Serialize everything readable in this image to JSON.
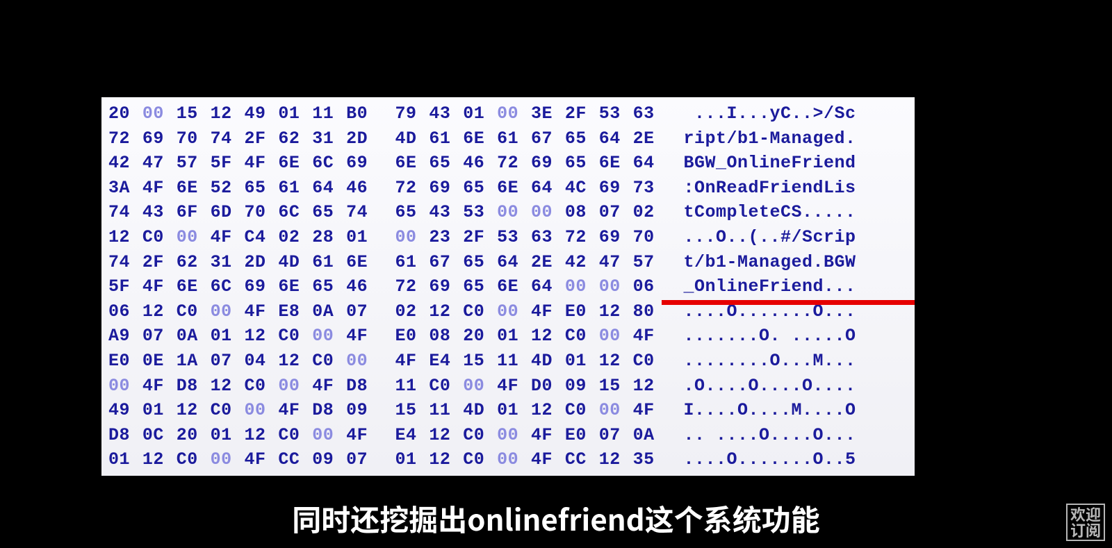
{
  "caption": "同时还挖掘出onlinefriend这个系统功能",
  "stamp": {
    "line1": "欢迎",
    "line2": "订阅"
  },
  "rows": [
    {
      "bytes": [
        "20",
        "00",
        "15",
        "12",
        "49",
        "01",
        "11",
        "B0",
        "79",
        "43",
        "01",
        "00",
        "3E",
        "2F",
        "53",
        "63"
      ],
      "ascii": " ...I...yC..>/Sc"
    },
    {
      "bytes": [
        "72",
        "69",
        "70",
        "74",
        "2F",
        "62",
        "31",
        "2D",
        "4D",
        "61",
        "6E",
        "61",
        "67",
        "65",
        "64",
        "2E"
      ],
      "ascii": "ript/b1-Managed."
    },
    {
      "bytes": [
        "42",
        "47",
        "57",
        "5F",
        "4F",
        "6E",
        "6C",
        "69",
        "6E",
        "65",
        "46",
        "72",
        "69",
        "65",
        "6E",
        "64"
      ],
      "ascii": "BGW_OnlineFriend"
    },
    {
      "bytes": [
        "3A",
        "4F",
        "6E",
        "52",
        "65",
        "61",
        "64",
        "46",
        "72",
        "69",
        "65",
        "6E",
        "64",
        "4C",
        "69",
        "73"
      ],
      "ascii": ":OnReadFriendLis"
    },
    {
      "bytes": [
        "74",
        "43",
        "6F",
        "6D",
        "70",
        "6C",
        "65",
        "74",
        "65",
        "43",
        "53",
        "00",
        "00",
        "08",
        "07",
        "02"
      ],
      "ascii": "tCompleteCS....."
    },
    {
      "bytes": [
        "12",
        "C0",
        "00",
        "4F",
        "C4",
        "02",
        "28",
        "01",
        "00",
        "23",
        "2F",
        "53",
        "63",
        "72",
        "69",
        "70"
      ],
      "ascii": "...O..(..#/Scrip"
    },
    {
      "bytes": [
        "74",
        "2F",
        "62",
        "31",
        "2D",
        "4D",
        "61",
        "6E",
        "61",
        "67",
        "65",
        "64",
        "2E",
        "42",
        "47",
        "57"
      ],
      "ascii": "t/b1-Managed.BGW"
    },
    {
      "bytes": [
        "5F",
        "4F",
        "6E",
        "6C",
        "69",
        "6E",
        "65",
        "46",
        "72",
        "69",
        "65",
        "6E",
        "64",
        "00",
        "00",
        "06"
      ],
      "ascii": "_OnlineFriend..."
    },
    {
      "bytes": [
        "06",
        "12",
        "C0",
        "00",
        "4F",
        "E8",
        "0A",
        "07",
        "02",
        "12",
        "C0",
        "00",
        "4F",
        "E0",
        "12",
        "80"
      ],
      "ascii": "....O.......O..."
    },
    {
      "bytes": [
        "A9",
        "07",
        "0A",
        "01",
        "12",
        "C0",
        "00",
        "4F",
        "E0",
        "08",
        "20",
        "01",
        "12",
        "C0",
        "00",
        "4F"
      ],
      "ascii": ".......O. .....O"
    },
    {
      "bytes": [
        "E0",
        "0E",
        "1A",
        "07",
        "04",
        "12",
        "C0",
        "00",
        "4F",
        "E4",
        "15",
        "11",
        "4D",
        "01",
        "12",
        "C0"
      ],
      "ascii": "........O...M..."
    },
    {
      "bytes": [
        "00",
        "4F",
        "D8",
        "12",
        "C0",
        "00",
        "4F",
        "D8",
        "11",
        "C0",
        "00",
        "4F",
        "D0",
        "09",
        "15",
        "12"
      ],
      "ascii": ".O....O....O...."
    },
    {
      "bytes": [
        "49",
        "01",
        "12",
        "C0",
        "00",
        "4F",
        "D8",
        "09",
        "15",
        "11",
        "4D",
        "01",
        "12",
        "C0",
        "00",
        "4F"
      ],
      "ascii": "I....O....M....O"
    },
    {
      "bytes": [
        "D8",
        "0C",
        "20",
        "01",
        "12",
        "C0",
        "00",
        "4F",
        "E4",
        "12",
        "C0",
        "00",
        "4F",
        "E0",
        "07",
        "0A"
      ],
      "ascii": ".. ....O....O..."
    },
    {
      "bytes": [
        "01",
        "12",
        "C0",
        "00",
        "4F",
        "CC",
        "09",
        "07",
        "01",
        "12",
        "C0",
        "00",
        "4F",
        "CC",
        "12",
        "35"
      ],
      "ascii": "....O.......O..5"
    }
  ]
}
